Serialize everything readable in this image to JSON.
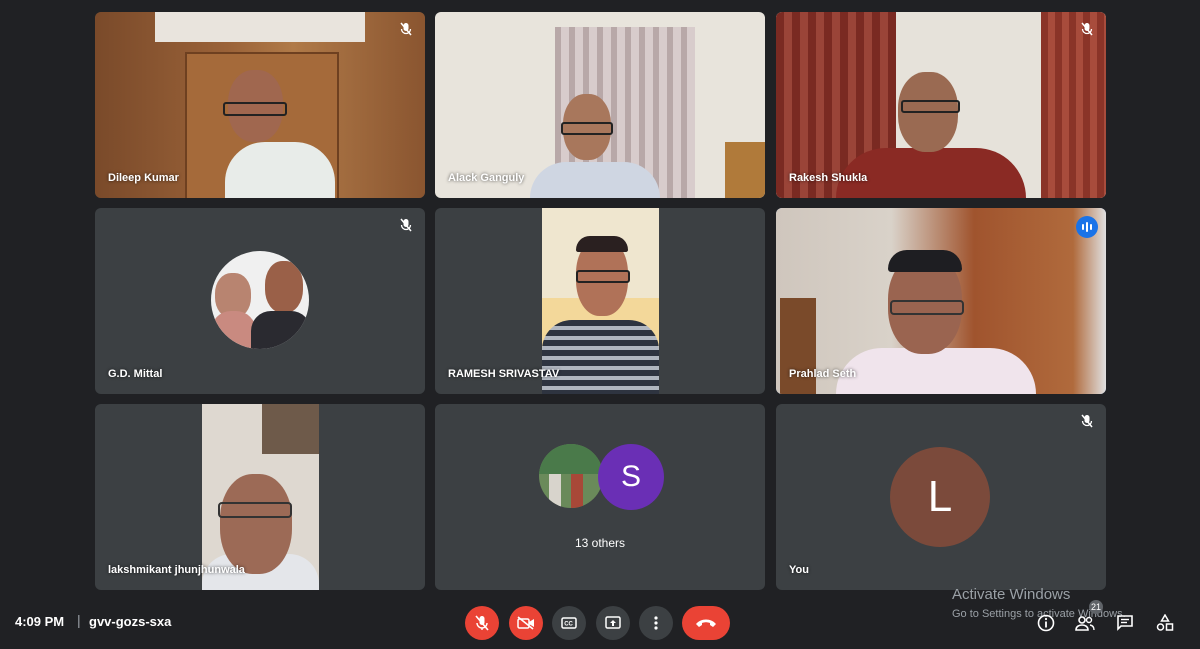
{
  "participants": [
    {
      "name": "Dileep Kumar",
      "muted": true
    },
    {
      "name": "Alack Ganguly",
      "muted": false
    },
    {
      "name": "Rakesh Shukla",
      "muted": true
    },
    {
      "name": "G.D. Mittal",
      "muted": true
    },
    {
      "name": "RAMESH SRIVASTAV",
      "muted": false
    },
    {
      "name": "Prahlad Seth",
      "speaking": true
    },
    {
      "name": "lakshmikant jhunjhunwala",
      "muted": false
    },
    {
      "name": "13 others",
      "avatar_letter": "S"
    },
    {
      "name": "You",
      "avatar_letter": "L",
      "muted": true
    }
  ],
  "meeting": {
    "time": "4:09 PM",
    "separator": "|",
    "code": "gvv-gozs-sxa",
    "participant_count": "21"
  },
  "watermark": {
    "title": "Activate Windows",
    "subtitle": "Go to Settings to activate Windows."
  },
  "icons": {
    "mic_off": "mic-off-icon",
    "camera_off": "camera-off-icon",
    "captions": "captions-icon",
    "present": "present-icon",
    "more": "more-options-icon",
    "end_call": "end-call-icon",
    "info": "info-icon",
    "people": "people-icon",
    "chat": "chat-icon",
    "activities": "activities-icon"
  },
  "colors": {
    "background": "#202124",
    "tile": "#3c4043",
    "danger": "#ea4335",
    "active_speaker": "#8ab4f8",
    "avatar_s": "#6a2fb5",
    "avatar_l": "#7b4a3b"
  }
}
